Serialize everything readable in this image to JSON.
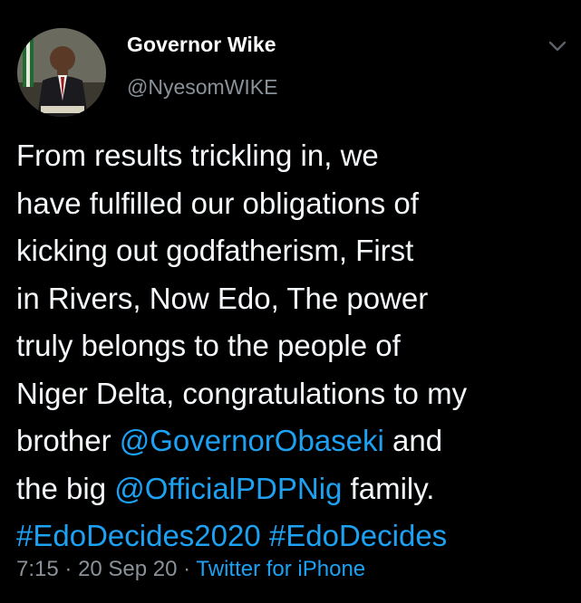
{
  "user": {
    "display_name": "Governor Wike",
    "handle": "@NyesomWIKE"
  },
  "tweet": {
    "line1": "From results trickling in, we",
    "line2": "have fulfilled our obligations of",
    "line3": "kicking out godfatherism, First",
    "line4": "in Rivers, Now Edo, The power",
    "line5": "truly belongs to the people of",
    "line6": "Niger Delta, congratulations to my",
    "line7_prefix": "brother ",
    "mention1": "@GovernorObaseki",
    "line7_suffix": " and",
    "line8_prefix": "the big ",
    "mention2": "@OfficialPDPNig",
    "line8_suffix": " family.",
    "hashtag1": "#EdoDecides2020",
    "hashtag2": "#EdoDecides"
  },
  "meta": {
    "time": "7:15",
    "separator": "·",
    "date": "20 Sep 20",
    "source": "Twitter for iPhone"
  },
  "icons": {
    "menu": "chevron-down-icon"
  },
  "colors": {
    "background": "#000000",
    "text": "#f5f8fa",
    "secondary_text": "#8a9198",
    "link": "#1da1f2"
  }
}
